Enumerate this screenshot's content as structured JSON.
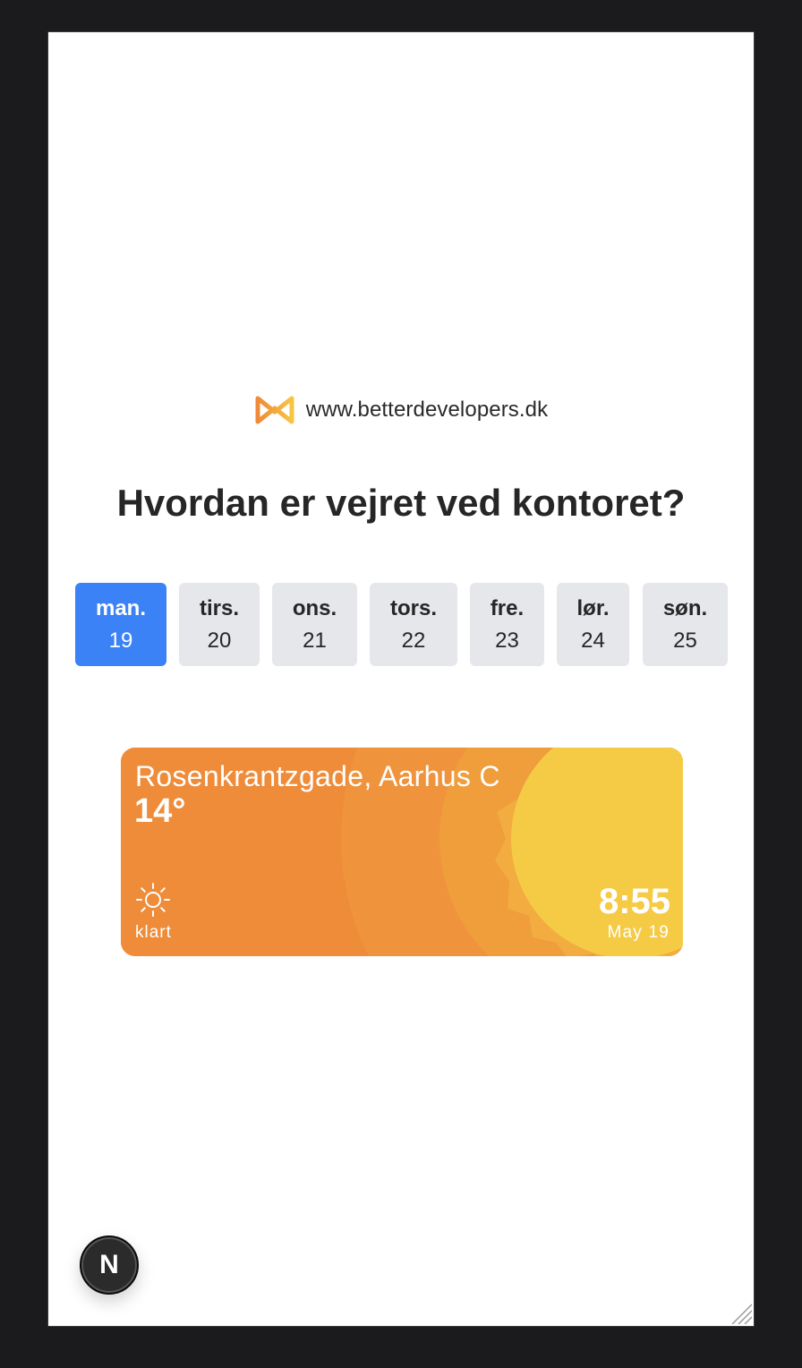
{
  "brand": {
    "url": "www.betterdevelopers.dk",
    "logo_icon": "infinity-logo-icon"
  },
  "headline": "Hvordan er vejret ved kontoret?",
  "days": [
    {
      "name": "man.",
      "num": "19",
      "active": true
    },
    {
      "name": "tirs.",
      "num": "20",
      "active": false
    },
    {
      "name": "ons.",
      "num": "21",
      "active": false
    },
    {
      "name": "tors.",
      "num": "22",
      "active": false
    },
    {
      "name": "fre.",
      "num": "23",
      "active": false
    },
    {
      "name": "lør.",
      "num": "24",
      "active": false
    },
    {
      "name": "søn.",
      "num": "25",
      "active": false
    }
  ],
  "weather": {
    "location": "Rosenkrantzgade, Aarhus C",
    "temperature": "14°",
    "condition": "klart",
    "condition_icon": "sun-icon",
    "time": "8:55",
    "date": "May 19"
  },
  "next_badge": {
    "label": "N"
  },
  "colors": {
    "accent": "#3b82f6",
    "day_inactive": "#e5e7eb",
    "card_orange": "#ee8c3a",
    "sun_yellow": "#f5cb45"
  }
}
